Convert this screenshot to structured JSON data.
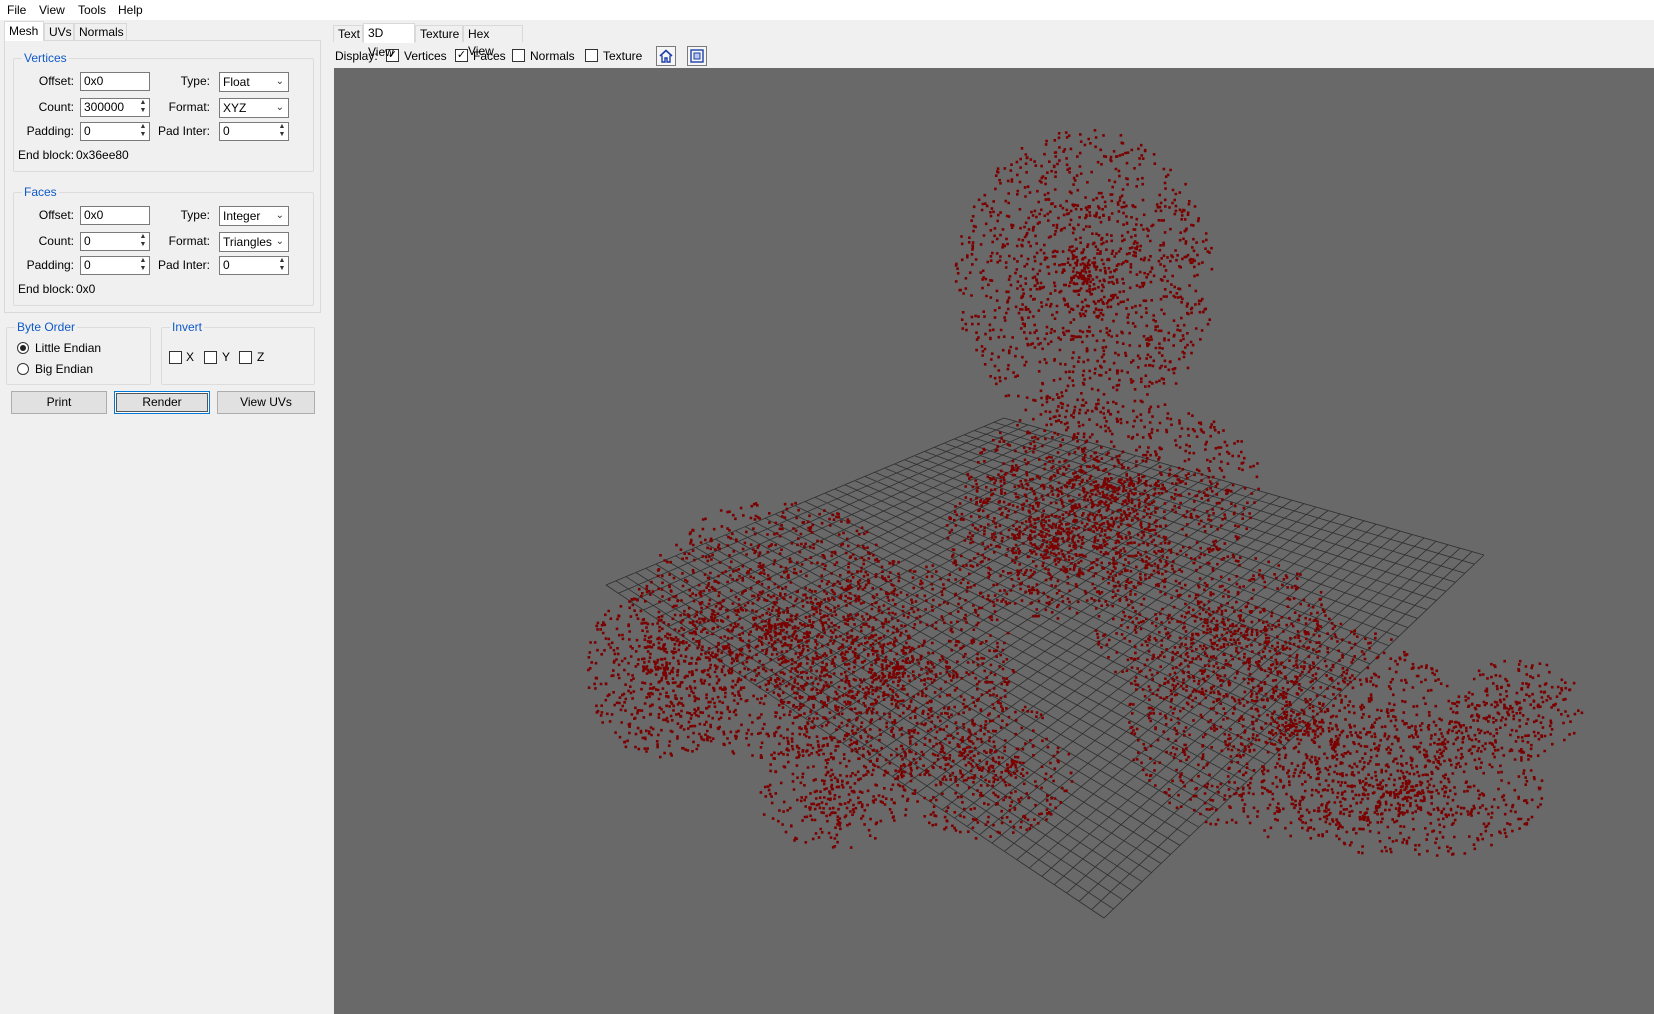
{
  "menu": [
    "File",
    "View",
    "Tools",
    "Help"
  ],
  "left_tabs": [
    "Mesh",
    "UVs",
    "Normals"
  ],
  "right_tabs": [
    "Text",
    "3D View",
    "Texture",
    "Hex View"
  ],
  "vertices": {
    "title": "Vertices",
    "offset_label": "Offset:",
    "offset_value": "0x0",
    "type_label": "Type:",
    "type_value": "Float",
    "count_label": "Count:",
    "count_value": "300000",
    "format_label": "Format:",
    "format_value": "XYZ",
    "padding_label": "Padding:",
    "padding_value": "0",
    "padinter_label": "Pad Inter:",
    "padinter_value": "0",
    "endblock_label": "End block:",
    "endblock_value": "0x36ee80"
  },
  "faces": {
    "title": "Faces",
    "offset_label": "Offset:",
    "offset_value": "0x0",
    "type_label": "Type:",
    "type_value": "Integer",
    "count_label": "Count:",
    "count_value": "0",
    "format_label": "Format:",
    "format_value": "Triangles",
    "padding_label": "Padding:",
    "padding_value": "0",
    "padinter_label": "Pad Inter:",
    "padinter_value": "0",
    "endblock_label": "End block:",
    "endblock_value": "0x0"
  },
  "byte_order": {
    "title": "Byte Order",
    "little": "Little Endian",
    "big": "Big Endian",
    "selected": "Little Endian"
  },
  "invert": {
    "title": "Invert",
    "x": "X",
    "y": "Y",
    "z": "Z"
  },
  "buttons": {
    "print": "Print",
    "render": "Render",
    "view_uvs": "View UVs"
  },
  "display": {
    "label": "Display:",
    "vertices": "Vertices",
    "vertices_checked": true,
    "faces": "Faces",
    "faces_checked": true,
    "normals": "Normals",
    "normals_checked": false,
    "texture": "Texture",
    "texture_checked": false
  },
  "colors": {
    "points": "#7b0000",
    "viewport_bg": "#696969",
    "grid": "#2e2e2e",
    "accent": "#0f59c8"
  },
  "icons": [
    "home-icon",
    "frame-icon"
  ]
}
